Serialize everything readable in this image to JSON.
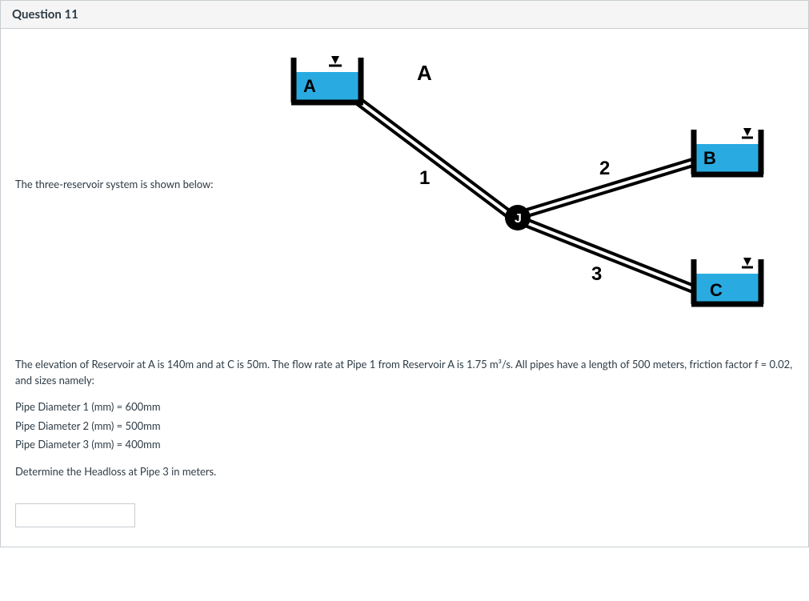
{
  "header": {
    "title": "Question 11"
  },
  "intro": "The three-reservoir system is shown below:",
  "diagram": {
    "reservoirs": {
      "a": "A",
      "b": "B",
      "c": "C"
    },
    "junction": "J",
    "labels": {
      "a": "A",
      "pipe1": "1",
      "pipe2": "2",
      "pipe3": "3"
    }
  },
  "details": {
    "para": "The elevation of Reservoir at A is 140m and at C is 50m. The flow rate at Pipe 1 from Reservoir A is 1.75 m³/s. All pipes have a length of 500 meters, friction factor f = 0.02, and sizes namely:",
    "d1": "Pipe Diameter 1 (mm) = 600mm",
    "d2": "Pipe Diameter 2 (mm) = 500mm",
    "d3": "Pipe Diameter 3 (mm) = 400mm",
    "prompt": "Determine the Headloss at Pipe 3 in meters."
  },
  "answer": {
    "value": ""
  }
}
